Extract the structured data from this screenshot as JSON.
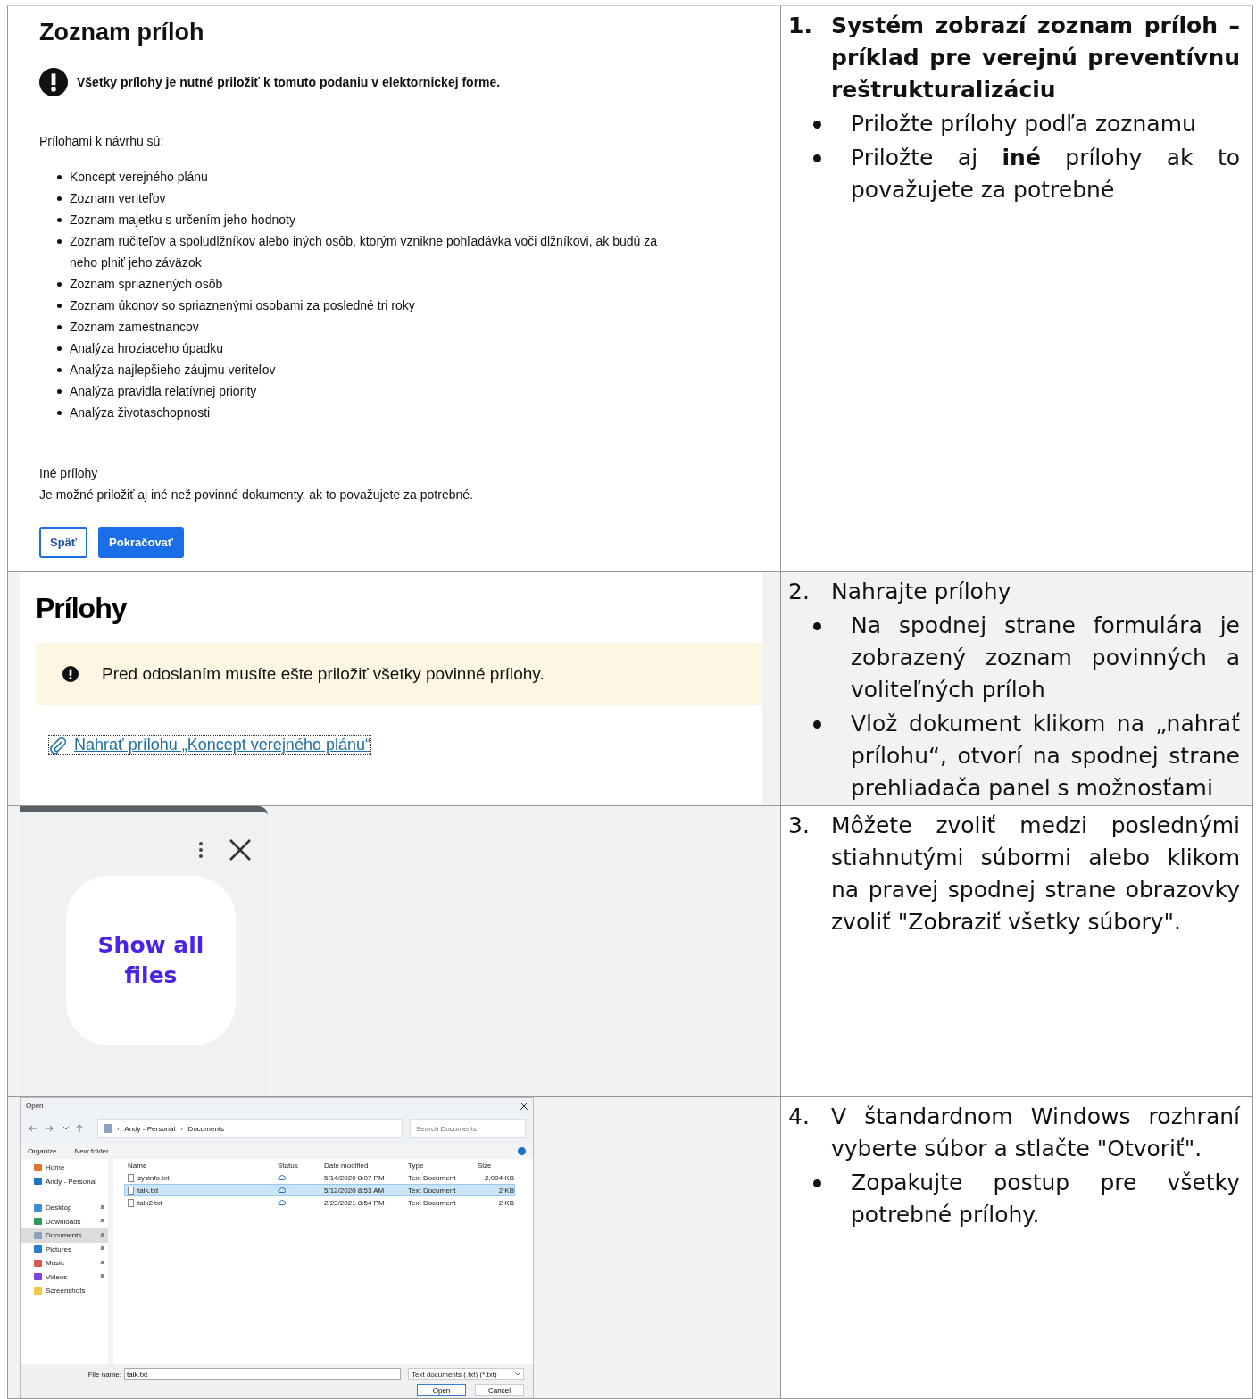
{
  "steps": [
    {
      "number": "1.",
      "title": "Systém zobrazí zoznam príloh – príklad pre verejnú preventívnu reštrukturalizáciu",
      "emphasis": true,
      "bullets": [
        "Priložte prílohy podľa zoznamu",
        "Priložte aj **iné** prílohy ak to považujete za potrebné"
      ],
      "screenshot": {
        "kind": "form",
        "heading": "Zoznam príloh",
        "warning": "Všetky prílohy je nutné priložiť k tomuto podaniu v elektornickej forme.",
        "intro": "Prílohami k návrhu sú:",
        "items": [
          "Koncept verejného plánu",
          "Zoznam veriteľov",
          "Zoznam majetku s určením jeho hodnoty",
          "Zoznam ručiteľov a spoludlžníkov alebo iných osôb, ktorým vznikne pohľadávka voči dlžníkovi, ak budú za neho plniť jeho záväzok",
          "Zoznam spriaznených osôb",
          "Zoznam úkonov so spriaznenými osobami za posledné tri roky",
          "Zoznam zamestnancov",
          "Analýza hroziaceho úpadku",
          "Analýza najlepšieho záujmu veriteľov",
          "Analýza pravidla relatívnej priority",
          "Analýza životaschopnosti"
        ],
        "other_heading": "Iné prílohy",
        "other_text": "Je možné priložiť aj iné než povinné dokumenty, ak to považujete za potrebné.",
        "buttons": [
          {
            "label": "Späť",
            "kind": "secondary"
          },
          {
            "label": "Pokračovať",
            "kind": "primary"
          }
        ]
      }
    },
    {
      "number": "2.",
      "title": "Nahrajte prílohy",
      "emphasis": false,
      "bullets": [
        "Na spodnej strane formulára je zobrazený zoznam povinných a voliteľných príloh",
        "Vlož dokument klikom na „nahrať prílohu“, otvorí na spodnej strane prehliadača panel s možnosťami"
      ],
      "screenshot": {
        "kind": "attachments",
        "heading": "Prílohy",
        "notice": "Pred odoslaním musíte ešte priložiť všetky povinné prílohy.",
        "link": "Nahrať prílohu „Koncept verejného plánu“"
      }
    },
    {
      "number": "3.",
      "title": "Môžete zvoliť medzi poslednými stiahnutými súbormi alebo klikom na pravej spodnej strane obrazovky zvoliť \"Zobraziť všetky súbory\".",
      "emphasis": false,
      "screenshot": {
        "kind": "picker",
        "tile": "Show all files"
      }
    },
    {
      "number": "4.",
      "title": "V štandardnom Windows rozhraní vyberte súbor a stlačte \"Otvoriť\".",
      "emphasis": false,
      "bullets": [
        "Zopakujte postup pre všetky potrebné prílohy."
      ],
      "screenshot": {
        "kind": "file_dialog",
        "title": "Open",
        "path": [
          "Andy - Personal",
          "Documents"
        ],
        "separator": "›",
        "search_placeholder": "Search Documents",
        "toolbar": [
          "Organize",
          "New folder"
        ],
        "nav": [
          {
            "label": "Home",
            "pinned": false,
            "selected": false
          },
          {
            "label": "Andy - Personal",
            "pinned": false,
            "selected": false
          },
          {
            "label": "Desktop",
            "pinned": true,
            "selected": false
          },
          {
            "label": "Downloads",
            "pinned": true,
            "selected": false
          },
          {
            "label": "Documents",
            "pinned": true,
            "selected": true
          },
          {
            "label": "Pictures",
            "pinned": true,
            "selected": false
          },
          {
            "label": "Music",
            "pinned": true,
            "selected": false
          },
          {
            "label": "Videos",
            "pinned": true,
            "selected": false
          },
          {
            "label": "Screenshots",
            "pinned": false,
            "selected": false
          }
        ],
        "columns": [
          "Name",
          "Status",
          "Date modified",
          "Type",
          "Size"
        ],
        "rows": [
          {
            "name": "sysinfo.txt",
            "date": "5/14/2020 8:07 PM",
            "type": "Text Document",
            "size": "2,094 KB",
            "selected": false
          },
          {
            "name": "talk.txt",
            "date": "5/12/2020 8:53 AM",
            "type": "Text Document",
            "size": "2 KB",
            "selected": true
          },
          {
            "name": "talk2.txt",
            "date": "2/23/2021 8:54 PM",
            "type": "Text Document",
            "size": "2 KB",
            "selected": false
          }
        ],
        "file_name_label": "File name:",
        "file_name": "talk.txt",
        "filter": "Text documents (.txt) (*.txt)",
        "buttons": [
          {
            "label": "Open",
            "kind": "primary"
          },
          {
            "label": "Cancel",
            "kind": "secondary"
          }
        ]
      }
    }
  ]
}
